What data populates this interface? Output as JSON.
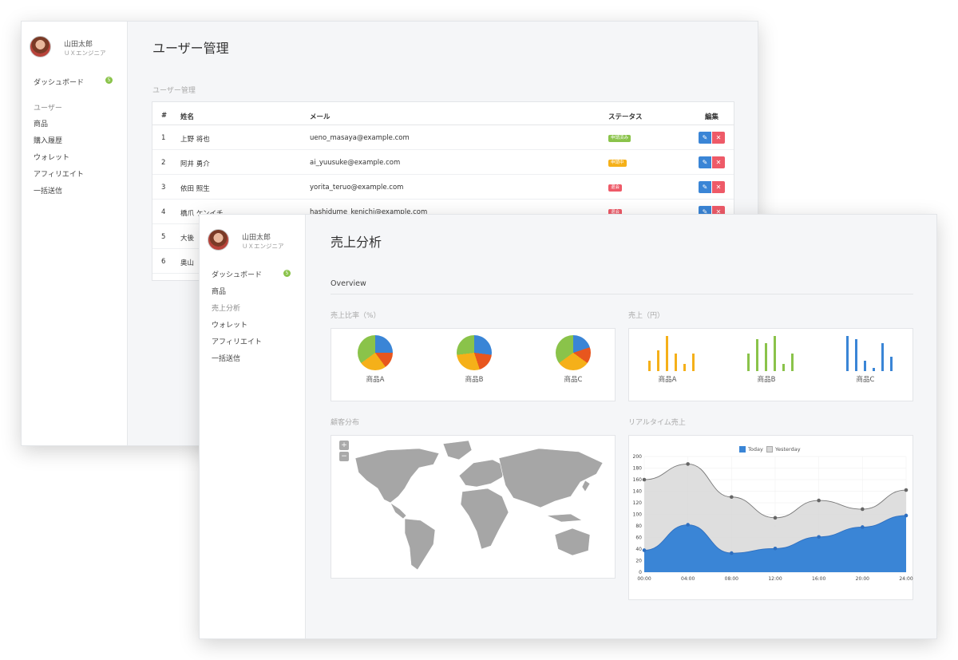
{
  "back": {
    "profile": {
      "name": "山田太郎",
      "role": "ＵＸエンジニア"
    },
    "nav": {
      "dashboard": "ダッシュボード",
      "dashboard_badge": "5",
      "section": "ユーザー",
      "items": [
        "商品",
        "購入履歴",
        "ウォレット",
        "アフィリエイト",
        "一括送信"
      ]
    },
    "page_title": "ユーザー管理",
    "section_title": "ユーザー管理",
    "table": {
      "headers": [
        "#",
        "姓名",
        "メール",
        "ステータス",
        "編集"
      ],
      "rows": [
        {
          "num": "1",
          "name": "上野 将也",
          "email": "ueno_masaya@example.com",
          "status": "申請済み",
          "status_color": "#8ac34a"
        },
        {
          "num": "2",
          "name": "阿井 勇介",
          "email": "ai_yuusuke@example.com",
          "status": "申請中",
          "status_color": "#f5b019"
        },
        {
          "num": "3",
          "name": "依田 照生",
          "email": "yorita_teruo@example.com",
          "status": "退会",
          "status_color": "#ee5a68"
        },
        {
          "num": "4",
          "name": "橋爪 ケンイチ",
          "email": "hashidume_kenichi@example.com",
          "status": "退会",
          "status_color": "#ee5a68"
        },
        {
          "num": "5",
          "name": "大後",
          "email": "",
          "status": "",
          "status_color": ""
        },
        {
          "num": "6",
          "name": "奥山",
          "email": "",
          "status": "",
          "status_color": ""
        }
      ],
      "edit_icon": "pencil-icon",
      "delete_icon": "close-icon"
    }
  },
  "front": {
    "profile": {
      "name": "山田太郎",
      "role": "ＵＸエンジニア"
    },
    "nav": {
      "dashboard": "ダッシュボード",
      "dashboard_badge": "5",
      "items": [
        "商品",
        "売上分析",
        "ウォレット",
        "アフィリエイト",
        "一括送信"
      ]
    },
    "page_title": "売上分析",
    "overview": "Overview",
    "pie_section": "売上比率（%）",
    "bar_section": "売上（円）",
    "map_section": "顧客分布",
    "line_section": "リアルタイム売上",
    "products": [
      "商品A",
      "商品B",
      "商品C"
    ],
    "zoom_in": "+",
    "zoom_out": "−",
    "colors": {
      "blue": "#3a85d6",
      "orange": "#f5b019",
      "green": "#8ac34a",
      "red": "#e8561e",
      "grey": "#bdbdbd"
    }
  },
  "chart_data": [
    {
      "type": "pie",
      "title": "売上比率（%）",
      "categories": [
        "商品A",
        "商品B",
        "商品C"
      ],
      "series": [
        {
          "name": "商品A",
          "values": [
            25,
            15,
            25,
            35
          ]
        },
        {
          "name": "商品B",
          "values": [
            27,
            18,
            28,
            27
          ]
        },
        {
          "name": "商品C",
          "values": [
            20,
            15,
            30,
            35
          ]
        }
      ]
    },
    {
      "type": "bar",
      "title": "売上（円）",
      "categories": [
        "商品A",
        "商品B",
        "商品C"
      ],
      "series": [
        {
          "name": "商品A",
          "values": [
            3,
            6,
            10,
            5,
            2,
            5
          ]
        },
        {
          "name": "商品B",
          "values": [
            5,
            9,
            8,
            10,
            2,
            5
          ]
        },
        {
          "name": "商品C",
          "values": [
            10,
            9,
            3,
            1,
            8,
            4
          ]
        }
      ]
    },
    {
      "type": "area",
      "title": "リアルタイム売上",
      "x": [
        "00:00",
        "04:00",
        "08:00",
        "12:00",
        "16:00",
        "20:00",
        "24:00"
      ],
      "ylim": [
        0,
        200
      ],
      "yticks": [
        0,
        20,
        40,
        60,
        80,
        100,
        120,
        140,
        160,
        180,
        200
      ],
      "grid": true,
      "legend": "top",
      "series": [
        {
          "name": "Today",
          "values": [
            38,
            82,
            33,
            41,
            61,
            78,
            98
          ],
          "color": "#3a85d6"
        },
        {
          "name": "Yesterday",
          "values": [
            160,
            187,
            130,
            94,
            124,
            109,
            142
          ],
          "color": "#d8d8d8"
        }
      ]
    }
  ]
}
